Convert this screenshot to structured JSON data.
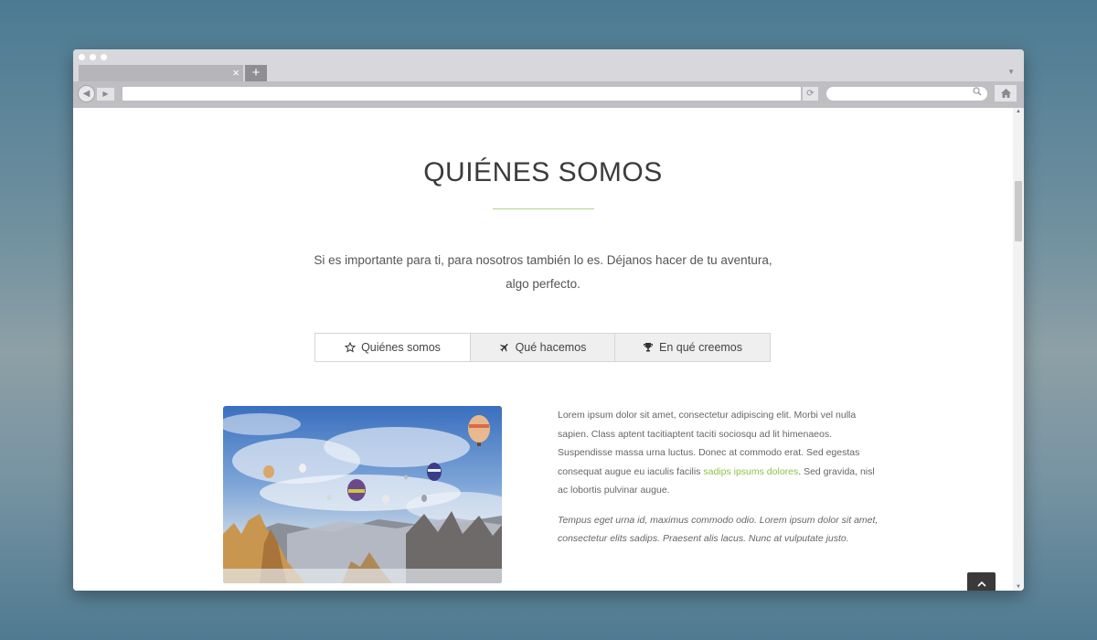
{
  "browser": {
    "tab_close": "×",
    "new_tab": "+",
    "tab_menu": "▼",
    "nav_back": "◀",
    "nav_forward": "▶",
    "reload": "⟳",
    "search_glyph": "⌕",
    "home_glyph": "⌂"
  },
  "page": {
    "title": "QUIÉNES SOMOS",
    "intro": "Si es importante para ti, para nosotros también lo es. Déjanos hacer de tu aventura, algo perfecto.",
    "tabs": [
      {
        "icon": "star-icon",
        "label": "Quiénes somos"
      },
      {
        "icon": "airplane-icon",
        "label": "Qué hacemos"
      },
      {
        "icon": "trophy-icon",
        "label": "En qué creemos"
      }
    ],
    "para1_before": "Lorem ipsum dolor sit amet, consectetur adipiscing elit. Morbi vel nulla sapien. Class aptent tacitiaptent taciti sociosqu ad lit himenaeos. Suspendisse massa urna luctus. Donec at commodo erat. Sed egestas consequat augue eu iaculis facilis ",
    "para1_link": "sadips ipsums dolores",
    "para1_after": ". Sed gravida, nisl ac lobortis pulvinar augue.",
    "para2": "Tempus eget urna id, maximus commodo odio. Lorem ipsum dolor sit amet, consectetur elits sadips. Praesent alis lacus. Nunc at vulputate justo.",
    "scroll_top": "⌃"
  },
  "colors": {
    "accent": "#8bc34a",
    "title_rule": "#b3d38b",
    "to_top_bg": "#3a3a3a"
  }
}
